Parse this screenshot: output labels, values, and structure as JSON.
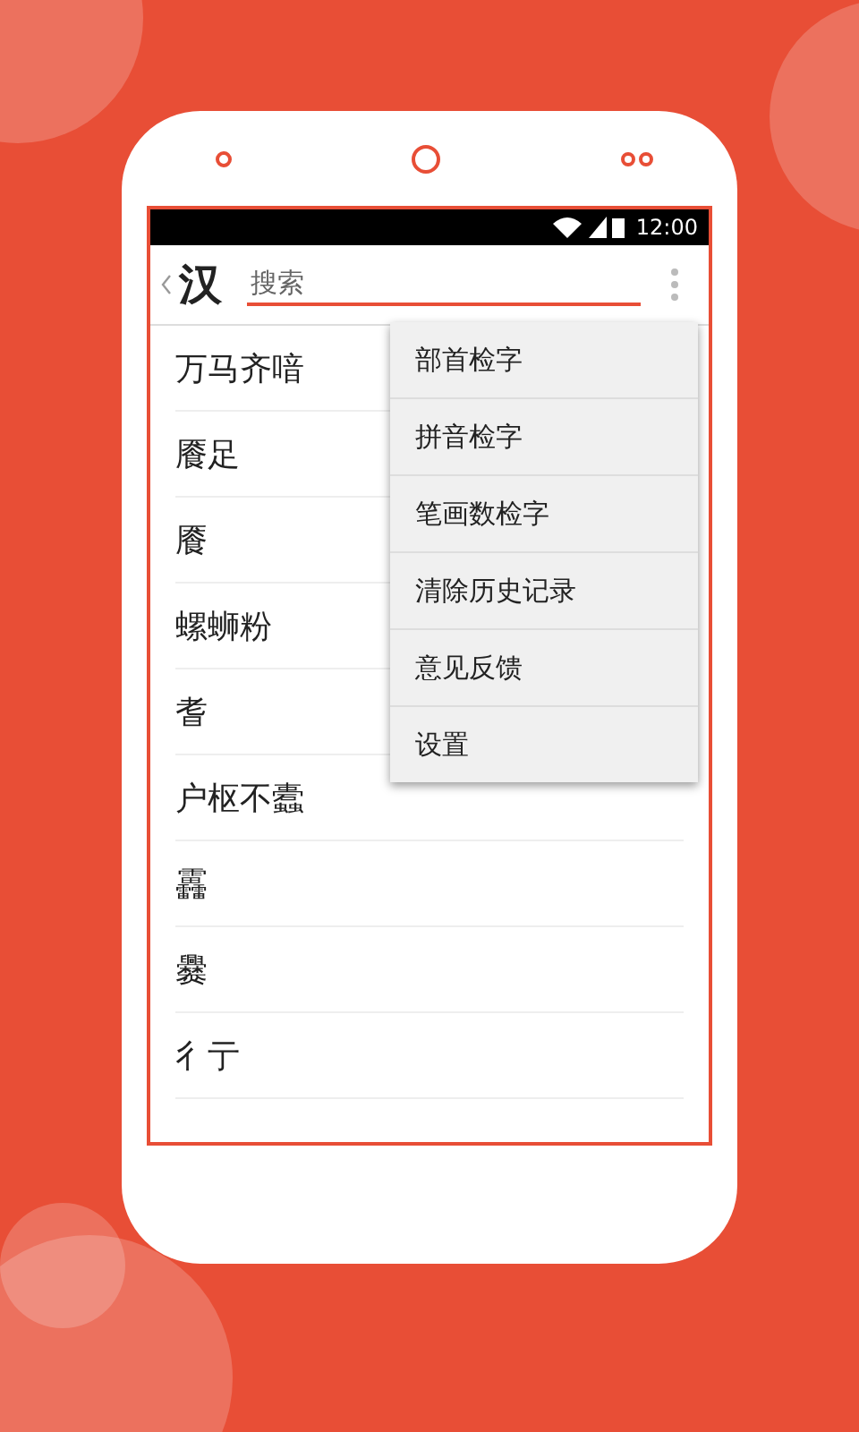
{
  "status_bar": {
    "time": "12:00"
  },
  "app_bar": {
    "logo": "汉",
    "search": {
      "placeholder": "搜索"
    }
  },
  "history": [
    {
      "text": "万马齐喑"
    },
    {
      "text": "餍足"
    },
    {
      "text": "餍"
    },
    {
      "text": "螺蛳粉"
    },
    {
      "text": "耆"
    },
    {
      "text": "户枢不蠹"
    },
    {
      "text": "靐"
    },
    {
      "text": "爨"
    },
    {
      "text": "彳亍"
    }
  ],
  "menu": [
    {
      "label": "部首检字"
    },
    {
      "label": "拼音检字"
    },
    {
      "label": "笔画数检字"
    },
    {
      "label": "清除历史记录"
    },
    {
      "label": "意见反馈"
    },
    {
      "label": "设置"
    }
  ]
}
